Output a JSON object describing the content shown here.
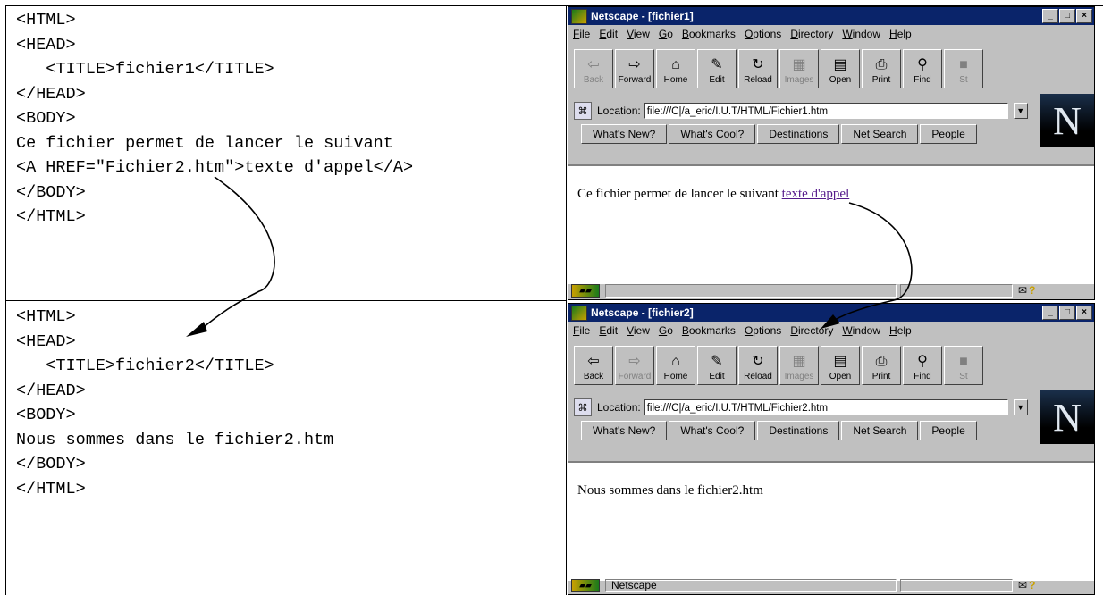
{
  "top": {
    "code_lines": [
      "<HTML>",
      "<HEAD>",
      "   <TITLE>fichier1</TITLE>",
      "</HEAD>",
      "<BODY>",
      "Ce fichier permet de lancer le suivant",
      "<A HREF=\"Fichier2.htm\">texte d'appel</A>",
      "</BODY>",
      "</HTML>"
    ],
    "window": {
      "title": "Netscape - [fichier1]",
      "location": "file:///C|/a_eric/I.U.T/HTML/Fichier1.htm",
      "content_text": "Ce fichier permet de lancer le suivant ",
      "link_text": "texte d'appel",
      "status": "",
      "back_enabled": false,
      "forward_enabled": true
    }
  },
  "bottom": {
    "code_lines": [
      "<HTML>",
      "<HEAD>",
      "   <TITLE>fichier2</TITLE>",
      "</HEAD>",
      "<BODY>",
      "Nous sommes dans le fichier2.htm",
      "</BODY>",
      "</HTML>"
    ],
    "window": {
      "title": "Netscape - [fichier2]",
      "location": "file:///C|/a_eric/I.U.T/HTML/Fichier2.htm",
      "content_text": "Nous sommes dans le fichier2.htm",
      "link_text": "",
      "status": "Netscape",
      "back_enabled": true,
      "forward_enabled": false
    }
  },
  "menu": [
    "File",
    "Edit",
    "View",
    "Go",
    "Bookmarks",
    "Options",
    "Directory",
    "Window",
    "Help"
  ],
  "toolbar": [
    {
      "icon": "back-arrow-icon",
      "glyph": "⇦",
      "label": "Back"
    },
    {
      "icon": "forward-arrow-icon",
      "glyph": "⇨",
      "label": "Forward"
    },
    {
      "icon": "home-icon",
      "glyph": "⌂",
      "label": "Home"
    },
    {
      "icon": "edit-pencil-icon",
      "glyph": "✎",
      "label": "Edit"
    },
    {
      "icon": "reload-icon",
      "glyph": "↻",
      "label": "Reload"
    },
    {
      "icon": "images-icon",
      "glyph": "▦",
      "label": "Images"
    },
    {
      "icon": "open-icon",
      "glyph": "▤",
      "label": "Open"
    },
    {
      "icon": "print-icon",
      "glyph": "⎙",
      "label": "Print"
    },
    {
      "icon": "find-icon",
      "glyph": "⚲",
      "label": "Find"
    },
    {
      "icon": "stop-icon",
      "glyph": "■",
      "label": "St"
    }
  ],
  "location_label": "Location:",
  "directory_buttons": [
    "What's New?",
    "What's Cool?",
    "Destinations",
    "Net Search",
    "People"
  ],
  "logo_letter": "N",
  "titlebar_glyphs": {
    "minimize": "_",
    "maximize": "□",
    "close": "×"
  },
  "status_icons": {
    "security": "▰▰",
    "mail": "✉",
    "help": "?"
  },
  "colors": {
    "titlebar": "#0a246a",
    "chrome": "#c0c0c0",
    "link": "#551a8b"
  }
}
